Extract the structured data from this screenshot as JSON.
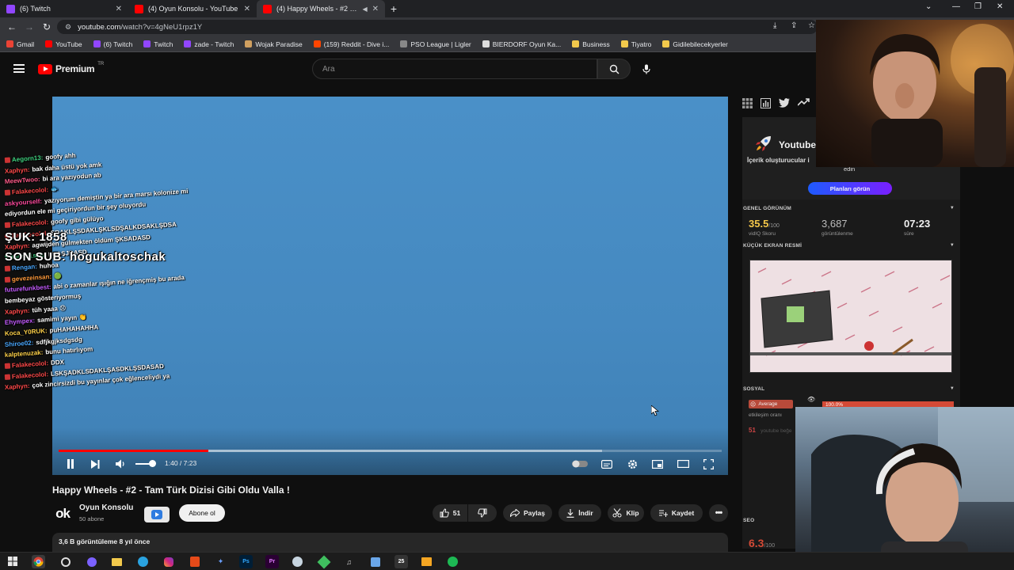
{
  "browser": {
    "tabs": [
      {
        "label": "(6) Twitch",
        "icon": "twitch-icon",
        "color": "#9146ff"
      },
      {
        "label": "(4) Oyun Konsolu - YouTube",
        "icon": "youtube-icon",
        "color": "#ff0000"
      },
      {
        "label": "(4) Happy Wheels - #2 - Tam",
        "icon": "youtube-icon",
        "color": "#ff0000",
        "active": true
      }
    ],
    "url_domain": "youtube.com",
    "url_path": "/watch?v=4gNeU1rpz1Y",
    "bookmarks": [
      {
        "label": "Gmail",
        "color": "#ea4335"
      },
      {
        "label": "YouTube",
        "color": "#ff0000"
      },
      {
        "label": "(6) Twitch",
        "color": "#9146ff"
      },
      {
        "label": "Twitch",
        "color": "#9146ff"
      },
      {
        "label": "zade - Twitch",
        "color": "#9146ff"
      },
      {
        "label": "Wojak Paradise",
        "color": "#d0a060"
      },
      {
        "label": "(159) Reddit - Dive i...",
        "color": "#ff4500"
      },
      {
        "label": "PSO League | Ligler",
        "color": "#888888"
      },
      {
        "label": "BIERDORF Oyun Ka...",
        "color": "#dddddd"
      },
      {
        "label": "Business",
        "color": "#f2c94c"
      },
      {
        "label": "Tiyatro",
        "color": "#f2c94c"
      },
      {
        "label": "Gidilebilecekyerler",
        "color": "#f2c94c"
      }
    ]
  },
  "youtube": {
    "logo_text": "Premium",
    "logo_sup": "TR",
    "search_placeholder": "Ara"
  },
  "player": {
    "current_time": "1:40",
    "duration": "7:23",
    "time_text": "1:40 / 7:23",
    "progress_fraction": 0.226,
    "buffer_fraction": 0.82,
    "volume_fraction": 0.7
  },
  "chat": [
    {
      "name": "Aegorn13:",
      "msg": "goofy ahh",
      "color": "#3fd17f",
      "badge": true
    },
    {
      "name": "Xaphyn:",
      "msg": "bak daha üstü yok amk",
      "color": "#ff4a4a",
      "badge": false
    },
    {
      "name": "MeewTwoo:",
      "msg": "bi ara yazıyodun ab",
      "color": "#ff5b8a",
      "badge": false
    },
    {
      "name": "Falakecolol:",
      "msg": "🐟",
      "color": "#ff4a4a",
      "badge": true
    },
    {
      "name": "askyourself:",
      "msg": "yazıyorum demiştin ya bir ara marsı kolonize mi",
      "color": "#ff4a9e",
      "badge": false
    },
    {
      "name": "",
      "msg": "ediyordun ele mi geçiriyordun bir şey oluyordu",
      "color": "#ffffff",
      "badge": false
    },
    {
      "name": "Falakecolol:",
      "msg": "goofy gibi gülüyo",
      "color": "#ff4a4a",
      "badge": true
    },
    {
      "name": "Falakecolol:",
      "msg": "SDAKLŞSDAKLŞKLSDŞALKDSAKLŞDSA",
      "color": "#ff4a4a",
      "badge": true
    },
    {
      "name": "Xaphyn:",
      "msg": "agwijden gülmekten öldüm ŞKSADASD",
      "color": "#ff4a4a",
      "badge": false
    },
    {
      "name": "Ertugrul1san:",
      "msg": "LKASJDASD",
      "color": "#3fd17f",
      "badge": false
    },
    {
      "name": "Rengan:",
      "msg": "huhoa",
      "color": "#4aa8ff",
      "badge": true
    },
    {
      "name": "gevezeinsan:",
      "msg": "🟢",
      "color": "#ff9a3c",
      "badge": true
    },
    {
      "name": "futurefunkbest:",
      "msg": "abi o zamanlar ışığın ne iğrençmiş bu arada",
      "color": "#c45bff",
      "badge": false
    },
    {
      "name": "",
      "msg": "bembeyaz gösteriyormuş",
      "color": "#ffffff",
      "badge": false
    },
    {
      "name": "Xaphyn:",
      "msg": "tüh yaaa 😞",
      "color": "#ff4a4a",
      "badge": false
    },
    {
      "name": "Ehympex:",
      "msg": "samimi yayın 👏",
      "color": "#c45bff",
      "badge": false
    },
    {
      "name": "Koca_Y0RUK:",
      "msg": "puHAHAHAHHA",
      "color": "#ffd24a",
      "badge": false
    },
    {
      "name": "Shiroe02:",
      "msg": "sdfjkgjksdgsdg",
      "color": "#4aa8ff",
      "badge": false
    },
    {
      "name": "kalptenuzak:",
      "msg": "bunu hatırlıyom",
      "color": "#ffd24a",
      "badge": false
    },
    {
      "name": "Falakecolol:",
      "msg": "DDX",
      "color": "#ff4a4a",
      "badge": true
    },
    {
      "name": "Falakecolol:",
      "msg": "LSKŞADKLSDAKLŞASDKLŞSDASAD",
      "color": "#ff4a4a",
      "badge": true
    },
    {
      "name": "Xaphyn:",
      "msg": "çok zincirsizdi bu yayınlar çok eğlenceliydi ya",
      "color": "#ff4a4a",
      "badge": false
    }
  ],
  "overlay": {
    "counter_1": "ŞUK: 1858",
    "counter_2": "SON SUB: hogukaltoschak"
  },
  "video": {
    "title": "Happy Wheels - #2 - Tam Türk Dizisi Gibi Oldu Valla !",
    "channel_name": "Oyun Konsolu",
    "channel_subs": "50 abone",
    "channel_avatar_text": "ok",
    "subscribe_label": "Abone ol",
    "like_count": "51",
    "share_label": "Paylaş",
    "download_label": "İndir",
    "clip_label": "Klip",
    "save_label": "Kaydet",
    "views_text": "3,6 B görüntüleme  8 yıl önce"
  },
  "vidiq": {
    "promo_title": "Youtube",
    "promo_sub": "İçerik oluşturucular i",
    "promo_sub2": "edin",
    "plans_label": "Planları görün",
    "overview_head": "GENEL GÖRÜNÜM",
    "score": "35.5",
    "score_max": "/100",
    "score_label": "vidIQ Skoru",
    "views": "3,687",
    "views_label": "görüntülenme",
    "duration": "07:23",
    "duration_label": "süre",
    "thumb_head": "KÜÇÜK EKRAN RESMİ",
    "social_head": "SOSYAL",
    "engagement_badge": "Average",
    "engagement_label": "etkileşim oranı",
    "engagement_pct": "100.0%",
    "engagement_fraction": 1.0,
    "likes_small": "51",
    "likes_small_label": "youtube beğe",
    "seo_head": "SEO",
    "seo_score": "6.3",
    "seo_max": "/100"
  }
}
